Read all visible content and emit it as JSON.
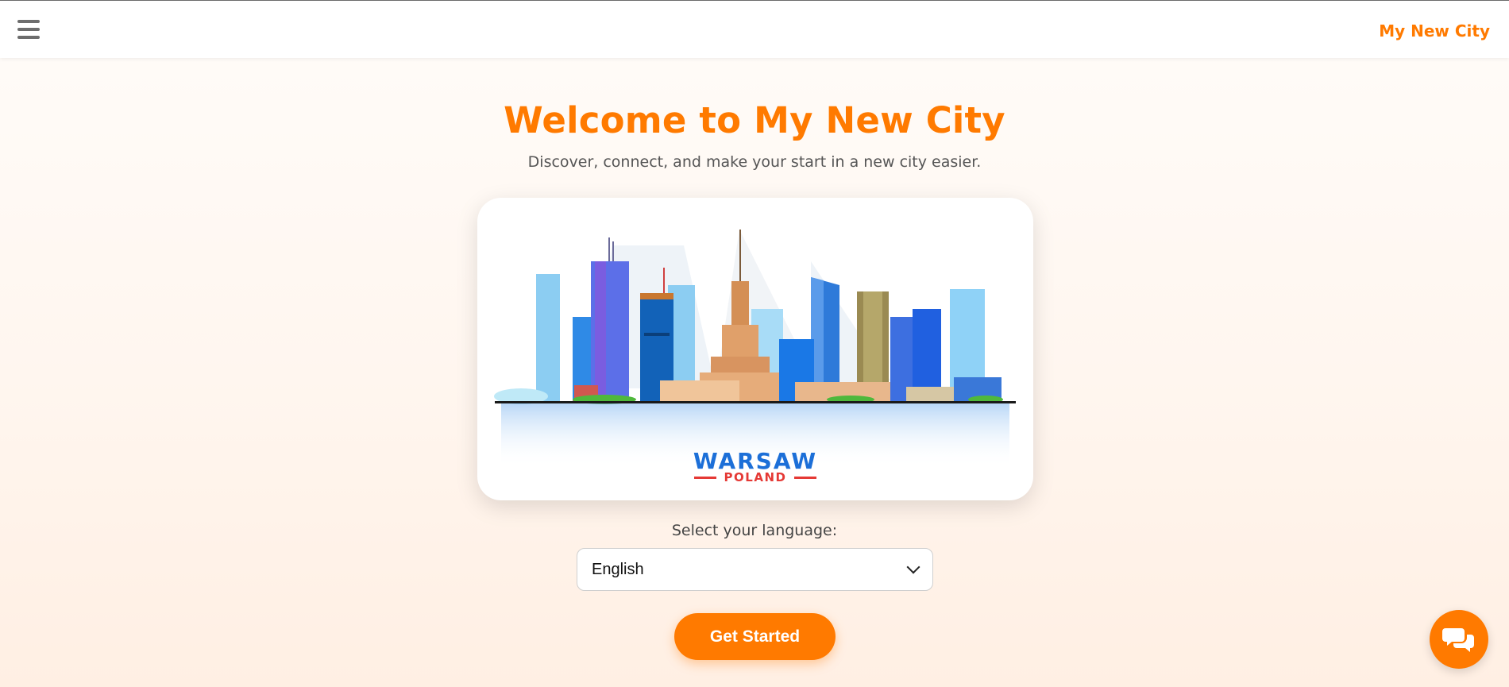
{
  "header": {
    "menu_icon": "hamburger-menu-icon",
    "brand": "My New City"
  },
  "hero": {
    "title": "Welcome to My New City",
    "subtitle": "Discover, connect, and make your start in a new city easier."
  },
  "city_image": {
    "city": "WARSAW",
    "country": "POLAND"
  },
  "language": {
    "label": "Select your language:",
    "selected": "English",
    "icon": "chevron-down-icon"
  },
  "cta": {
    "label": "Get Started"
  },
  "chat": {
    "icon": "chat-bubbles-icon"
  },
  "colors": {
    "accent": "#ff7a00",
    "city_text": "#1c6fd8",
    "country_text": "#e53935"
  }
}
